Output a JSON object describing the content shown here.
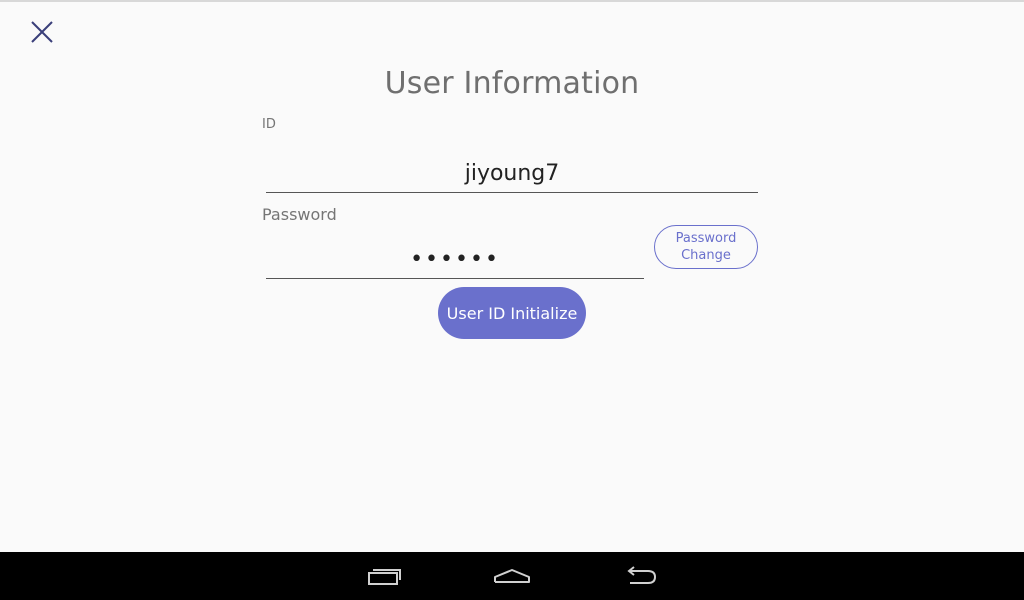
{
  "window": {
    "title": "User Information"
  },
  "form": {
    "id_label": "ID",
    "id_value": "jiyoung7",
    "password_label": "Password",
    "password_value": "••••••",
    "password_change_label": "Password\nChange",
    "initialize_label": "User ID Initialize"
  },
  "icons": {
    "close": "close-icon",
    "recent_apps": "recent-apps-icon",
    "home": "home-icon",
    "back": "back-icon"
  },
  "colors": {
    "accent": "#6a70cc",
    "background": "#fafafa",
    "close_icon": "#3a3f7a",
    "navbar": "#000000"
  }
}
